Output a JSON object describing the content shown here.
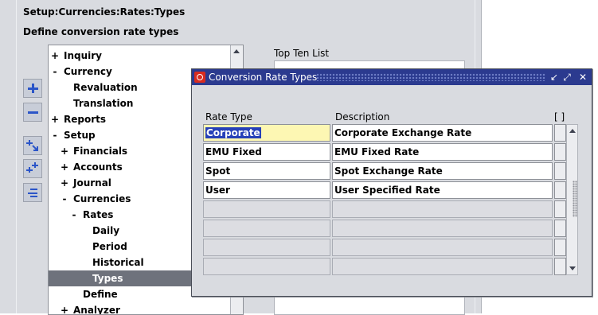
{
  "nav_window": {
    "title": "Setup:Currencies:Rates:Types",
    "subtitle": "Define conversion rate types",
    "tree": [
      {
        "marker": "+",
        "label": "Inquiry"
      },
      {
        "marker": "-",
        "label": "Currency"
      },
      {
        "marker": "",
        "label": "Revaluation"
      },
      {
        "marker": "",
        "label": "Translation"
      },
      {
        "marker": "+",
        "label": "Reports"
      },
      {
        "marker": "-",
        "label": "Setup"
      },
      {
        "marker": "+",
        "label": "Financials"
      },
      {
        "marker": "+",
        "label": "Accounts"
      },
      {
        "marker": "+",
        "label": "Journal"
      },
      {
        "marker": "-",
        "label": "Currencies"
      },
      {
        "marker": "-",
        "label": "Rates"
      },
      {
        "marker": "",
        "label": "Daily"
      },
      {
        "marker": "",
        "label": "Period"
      },
      {
        "marker": "",
        "label": "Historical"
      },
      {
        "marker": "",
        "label": "Types"
      },
      {
        "marker": "",
        "label": "Define"
      },
      {
        "marker": "+",
        "label": "Analyzer"
      }
    ],
    "selected_item": "Types",
    "top_ten_label": "Top Ten List",
    "toolbar_icons": [
      "expand-icon",
      "collapse-icon",
      "expand-branch-icon",
      "expand-all-icon",
      "collapse-all-icon"
    ]
  },
  "modal": {
    "title": "Conversion Rate Types",
    "title_controls": [
      "minimize-icon",
      "maximize-icon",
      "close-icon"
    ],
    "col_rate_type": "Rate Type",
    "col_description": "Description",
    "col_flag": "[ ]",
    "rows": [
      {
        "rate_type": "Corporate",
        "description": "Corporate Exchange Rate"
      },
      {
        "rate_type": "EMU Fixed",
        "description": "EMU Fixed Rate"
      },
      {
        "rate_type": "Spot",
        "description": "Spot Exchange Rate"
      },
      {
        "rate_type": "User",
        "description": "User Specified Rate"
      },
      {
        "rate_type": "",
        "description": ""
      },
      {
        "rate_type": "",
        "description": ""
      },
      {
        "rate_type": "",
        "description": ""
      },
      {
        "rate_type": "",
        "description": ""
      }
    ]
  },
  "colors": {
    "title_bar": "#2b3a8f",
    "selection": "#6e727c",
    "current_field": "#fdf7b3",
    "text_highlight": "#2640b8",
    "oracle_red": "#d82c20"
  }
}
